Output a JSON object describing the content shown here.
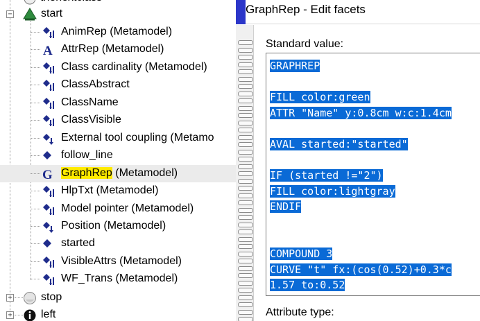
{
  "tree": {
    "top_cut": "thenextclass",
    "start": "start",
    "children": [
      {
        "label": "AnimRep",
        "suffix": " (Metamodel)",
        "icon": "attribute-icon"
      },
      {
        "label": "AttrRep",
        "suffix": " (Metamodel)",
        "icon": "letter-a-icon"
      },
      {
        "label": "Class cardinality",
        "suffix": " (Metamodel)",
        "icon": "attribute-icon"
      },
      {
        "label": "ClassAbstract",
        "suffix": "",
        "icon": "attribute-icon"
      },
      {
        "label": "ClassName",
        "suffix": "",
        "icon": "attribute-icon"
      },
      {
        "label": "ClassVisible",
        "suffix": "",
        "icon": "attribute-icon"
      },
      {
        "label": "External tool coupling",
        "suffix": " (Metamo",
        "icon": "attribute-small-icon"
      },
      {
        "label": "follow_line",
        "suffix": "",
        "icon": "diamond-icon"
      },
      {
        "label": "GraphRep",
        "suffix": " (Metamodel)",
        "icon": "letter-g-icon"
      },
      {
        "label": "HlpTxt",
        "suffix": " (Metamodel)",
        "icon": "attribute-icon"
      },
      {
        "label": "Model pointer",
        "suffix": " (Metamodel)",
        "icon": "attribute-icon"
      },
      {
        "label": "Position",
        "suffix": " (Metamodel)",
        "icon": "attribute-small-icon"
      },
      {
        "label": "started",
        "suffix": "",
        "icon": "diamond-icon"
      },
      {
        "label": "VisibleAttrs",
        "suffix": " (Metamodel)",
        "icon": "attribute-icon"
      },
      {
        "label": "WF_Trans",
        "suffix": " (Metamodel)",
        "icon": "attribute-icon"
      }
    ],
    "stop": "stop",
    "left": "left",
    "colors": {
      "start_triangle": "#2e8b3e",
      "highlight": "#ffeb00",
      "selection": "#ebebeb",
      "letter_icon": "#1f2c8c"
    }
  },
  "dialog": {
    "title": "GraphRep - Edit facets",
    "standard_value_label": "Standard value:",
    "attribute_type_label": "Attribute type:",
    "code_lines": [
      "GRAPHREP",
      "",
      "FILL color:green",
      "ATTR \"Name\" y:0.8cm w:c:1.4cm",
      "",
      "AVAL started:\"started\"",
      "",
      "IF (started !=\"2\")",
      "FILL color:lightgray",
      "ENDIF",
      "",
      "",
      "COMPOUND 3",
      "CURVE \"t\" fx:(cos(0.52)+0.3*c",
      "1.57 to:0.52"
    ],
    "colors": {
      "selection": "#0a6ad6",
      "accent": "#2b36c9"
    }
  }
}
